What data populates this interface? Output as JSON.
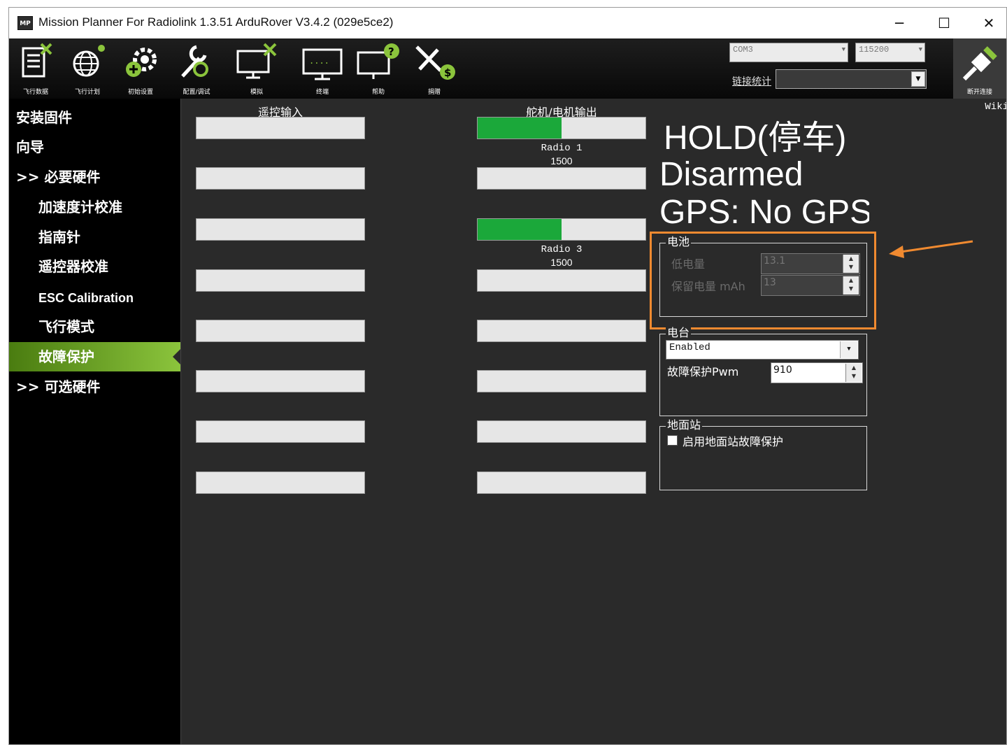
{
  "window": {
    "title": "Mission Planner For Radiolink 1.3.51 ArduRover V3.4.2 (029e5ce2)",
    "app_icon_text": "MP",
    "minimize": "─",
    "maximize": "☐",
    "close": "✕"
  },
  "toolbar": {
    "items": [
      {
        "label": "飞行数据",
        "icon": "flight-data-icon"
      },
      {
        "label": "飞行计划",
        "icon": "flight-plan-icon"
      },
      {
        "label": "初始设置",
        "icon": "initial-setup-icon"
      },
      {
        "label": "配置/调试",
        "icon": "config-tuning-icon"
      },
      {
        "label": "模拟",
        "icon": "simulation-icon"
      },
      {
        "label": "终端",
        "icon": "terminal-icon"
      },
      {
        "label": "帮助",
        "icon": "help-icon"
      },
      {
        "label": "捐赠",
        "icon": "donate-icon"
      }
    ],
    "port": "COM3",
    "baud": "115200",
    "stats_link": "链接统计",
    "connect_label": "断开连接"
  },
  "sidebar": {
    "items": [
      {
        "label": "安装固件"
      },
      {
        "label": "向导"
      },
      {
        "label": ">> 必要硬件"
      },
      {
        "label": "加速度计校准"
      },
      {
        "label": "指南针"
      },
      {
        "label": "遥控器校准"
      },
      {
        "label": "ESC Calibration"
      },
      {
        "label": "飞行模式"
      },
      {
        "label": "故障保护"
      },
      {
        "label": ">> 可选硬件"
      }
    ],
    "active": "故障保护"
  },
  "main": {
    "wiki": "Wiki",
    "rc_input_title": "遥控输入",
    "servo_output_title": "舵机/电机输出",
    "servo_outputs": [
      {
        "label": "Radio 1",
        "value": "1500",
        "fill": 0.5
      },
      {
        "label": "Radio 3",
        "value": "1500",
        "fill": 0.5
      }
    ],
    "status": {
      "mode": "HOLD(停车)",
      "armed": "Disarmed",
      "gps": "GPS: No GPS"
    },
    "battery": {
      "title": "电池",
      "low_voltage_label": "低电量",
      "low_voltage_value": "13.1",
      "reserve_mah_label": "保留电量 mAh",
      "reserve_mah_value": "13"
    },
    "radio": {
      "title": "电台",
      "mode": "Enabled",
      "pwm_label": "故障保护Pwm",
      "pwm_value": "910"
    },
    "gcs": {
      "title": "地面站",
      "checkbox_label": "启用地面站故障保护"
    }
  },
  "colors": {
    "accent_green": "#1ba83a",
    "highlight_orange": "#f08a30"
  }
}
